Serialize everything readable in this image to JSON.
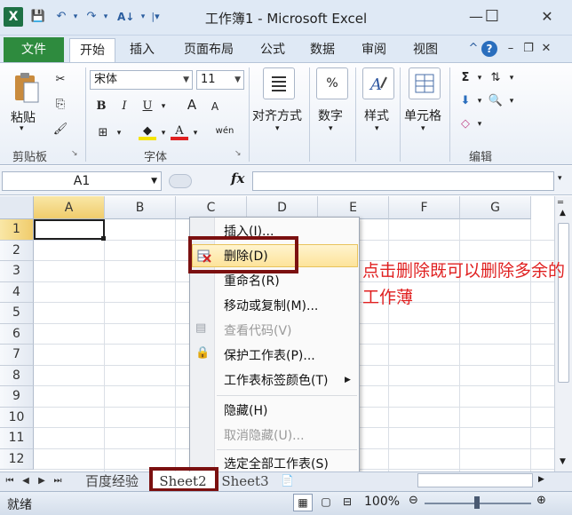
{
  "window": {
    "title": "工作簿1 - Microsoft Excel",
    "app_icon_letter": "X",
    "minimize": "—",
    "maximize": "☐",
    "close": "✕"
  },
  "ribbon": {
    "tabs": [
      "文件",
      "开始",
      "插入",
      "页面布局",
      "公式",
      "数据",
      "审阅",
      "视图"
    ],
    "active_tab": "开始",
    "clipboard": {
      "paste_label": "粘贴",
      "group_label": "剪贴板"
    },
    "font": {
      "name": "宋体",
      "size": "11",
      "group_label": "字体",
      "bold": "B",
      "italic": "I",
      "underline": "U",
      "grow": "A",
      "shrink": "A",
      "wen": "wén"
    },
    "alignment_label": "对齐方式",
    "number_label": "数字",
    "number_icon": "%",
    "styles_label": "样式",
    "cells_label": "单元格",
    "editing_label": "编辑",
    "sigma": "Σ"
  },
  "formula_bar": {
    "name_box": "A1",
    "fx": "fx"
  },
  "grid": {
    "columns": [
      "A",
      "B",
      "C",
      "D",
      "E",
      "F",
      "G"
    ],
    "rows": [
      "1",
      "2",
      "3",
      "4",
      "5",
      "6",
      "7",
      "8",
      "9",
      "10",
      "11",
      "12"
    ]
  },
  "context_menu": {
    "items": [
      {
        "label": "插入(I)...",
        "disabled": false
      },
      {
        "label": "删除(D)",
        "disabled": false,
        "highlighted": true
      },
      {
        "label": "重命名(R)",
        "disabled": false
      },
      {
        "label": "移动或复制(M)...",
        "disabled": false
      },
      {
        "label": "查看代码(V)",
        "disabled": true
      },
      {
        "label": "保护工作表(P)...",
        "disabled": false
      },
      {
        "label": "工作表标签颜色(T)",
        "disabled": false,
        "submenu": true
      },
      {
        "label": "隐藏(H)",
        "disabled": false
      },
      {
        "label": "取消隐藏(U)...",
        "disabled": true
      },
      {
        "label": "选定全部工作表(S)",
        "disabled": false
      }
    ]
  },
  "sheet_tabs": [
    "百度经验",
    "Sheet2",
    "Sheet3"
  ],
  "active_sheet": "Sheet2",
  "status": {
    "ready": "就绪",
    "zoom": "100%"
  },
  "annotation": "点击删除既可以删除多余的工作薄",
  "colors": {
    "file_tab": "#2e8b3e",
    "highlight_box": "#7b1010",
    "annotation": "#e02020",
    "menu_hover": "#fde39a"
  }
}
